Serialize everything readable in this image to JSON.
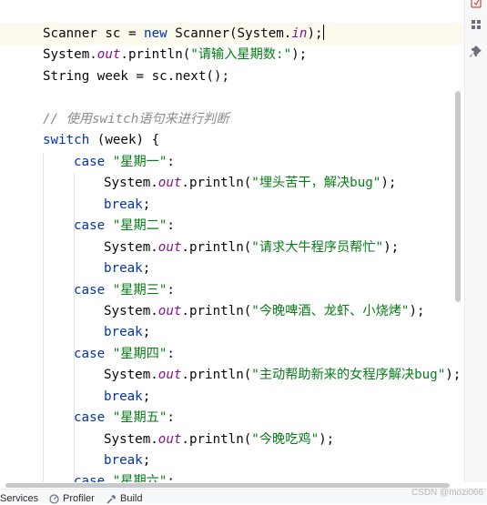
{
  "editor": {
    "lines": [
      {
        "parts": [
          {
            "t": "Scanner sc = ",
            "c": ""
          },
          {
            "t": "new",
            "c": "kw"
          },
          {
            "t": " Scanner(System.",
            "c": ""
          },
          {
            "t": "in",
            "c": "fld"
          },
          {
            "t": ");",
            "c": ""
          }
        ]
      },
      {
        "parts": [
          {
            "t": "System.",
            "c": ""
          },
          {
            "t": "out",
            "c": "fld"
          },
          {
            "t": ".println(",
            "c": ""
          },
          {
            "t": "\"请输入星期数:\"",
            "c": "str"
          },
          {
            "t": ");",
            "c": ""
          }
        ]
      },
      {
        "parts": [
          {
            "t": "String week = sc.next();",
            "c": ""
          }
        ]
      },
      {
        "parts": []
      },
      {
        "parts": [
          {
            "t": "// 使用switch语句来进行判断",
            "c": "cmt"
          }
        ]
      },
      {
        "parts": [
          {
            "t": "switch",
            "c": "kw"
          },
          {
            "t": " (week) {",
            "c": ""
          }
        ]
      },
      {
        "parts": [
          {
            "t": "case",
            "c": "kw"
          },
          {
            "t": " ",
            "c": ""
          },
          {
            "t": "\"星期一\"",
            "c": "str"
          },
          {
            "t": ":",
            "c": ""
          }
        ]
      },
      {
        "parts": [
          {
            "t": "System.",
            "c": ""
          },
          {
            "t": "out",
            "c": "fld"
          },
          {
            "t": ".println(",
            "c": ""
          },
          {
            "t": "\"埋头苦干，解决bug\"",
            "c": "str"
          },
          {
            "t": ");",
            "c": ""
          }
        ]
      },
      {
        "parts": [
          {
            "t": "break",
            "c": "kw"
          },
          {
            "t": ";",
            "c": ""
          }
        ]
      },
      {
        "parts": [
          {
            "t": "case",
            "c": "kw"
          },
          {
            "t": " ",
            "c": ""
          },
          {
            "t": "\"星期二\"",
            "c": "str"
          },
          {
            "t": ":",
            "c": ""
          }
        ]
      },
      {
        "parts": [
          {
            "t": "System.",
            "c": ""
          },
          {
            "t": "out",
            "c": "fld"
          },
          {
            "t": ".println(",
            "c": ""
          },
          {
            "t": "\"请求大牛程序员帮忙\"",
            "c": "str"
          },
          {
            "t": ");",
            "c": ""
          }
        ]
      },
      {
        "parts": [
          {
            "t": "break",
            "c": "kw"
          },
          {
            "t": ";",
            "c": ""
          }
        ]
      },
      {
        "parts": [
          {
            "t": "case",
            "c": "kw"
          },
          {
            "t": " ",
            "c": ""
          },
          {
            "t": "\"星期三\"",
            "c": "str"
          },
          {
            "t": ":",
            "c": ""
          }
        ]
      },
      {
        "parts": [
          {
            "t": "System.",
            "c": ""
          },
          {
            "t": "out",
            "c": "fld"
          },
          {
            "t": ".println(",
            "c": ""
          },
          {
            "t": "\"今晚啤酒、龙虾、小烧烤\"",
            "c": "str"
          },
          {
            "t": ");",
            "c": ""
          }
        ]
      },
      {
        "parts": [
          {
            "t": "break",
            "c": "kw"
          },
          {
            "t": ";",
            "c": ""
          }
        ]
      },
      {
        "parts": [
          {
            "t": "case",
            "c": "kw"
          },
          {
            "t": " ",
            "c": ""
          },
          {
            "t": "\"星期四\"",
            "c": "str"
          },
          {
            "t": ":",
            "c": ""
          }
        ]
      },
      {
        "parts": [
          {
            "t": "System.",
            "c": ""
          },
          {
            "t": "out",
            "c": "fld"
          },
          {
            "t": ".println(",
            "c": ""
          },
          {
            "t": "\"主动帮助新来的女程序解决bug\"",
            "c": "str"
          },
          {
            "t": ");",
            "c": ""
          }
        ]
      },
      {
        "parts": [
          {
            "t": "break",
            "c": "kw"
          },
          {
            "t": ";",
            "c": ""
          }
        ]
      },
      {
        "parts": [
          {
            "t": "case",
            "c": "kw"
          },
          {
            "t": " ",
            "c": ""
          },
          {
            "t": "\"星期五\"",
            "c": "str"
          },
          {
            "t": ":",
            "c": ""
          }
        ]
      },
      {
        "parts": [
          {
            "t": "System.",
            "c": ""
          },
          {
            "t": "out",
            "c": "fld"
          },
          {
            "t": ".println(",
            "c": ""
          },
          {
            "t": "\"今晚吃鸡\"",
            "c": "str"
          },
          {
            "t": ");",
            "c": ""
          }
        ]
      },
      {
        "parts": [
          {
            "t": "break",
            "c": "kw"
          },
          {
            "t": ";",
            "c": ""
          }
        ]
      },
      {
        "parts": [
          {
            "t": "case",
            "c": "kw"
          },
          {
            "t": " ",
            "c": ""
          },
          {
            "t": "\"星期六\"",
            "c": "str"
          },
          {
            "t": ":",
            "c": ""
          }
        ]
      }
    ]
  },
  "colors": {
    "keyword": "#0033b3",
    "string": "#067d17",
    "static_field": "#871094",
    "comment": "#8c8c8c",
    "current_line": "#fcfaed"
  },
  "right_strip": {
    "icons": [
      "bookmark-icon",
      "structure-icon",
      "pin-icon"
    ]
  },
  "bottom_bar": {
    "services_label": "Services",
    "profiler_label": "Profiler",
    "build_label": "Build"
  },
  "watermark": "CSDN @mozi066"
}
